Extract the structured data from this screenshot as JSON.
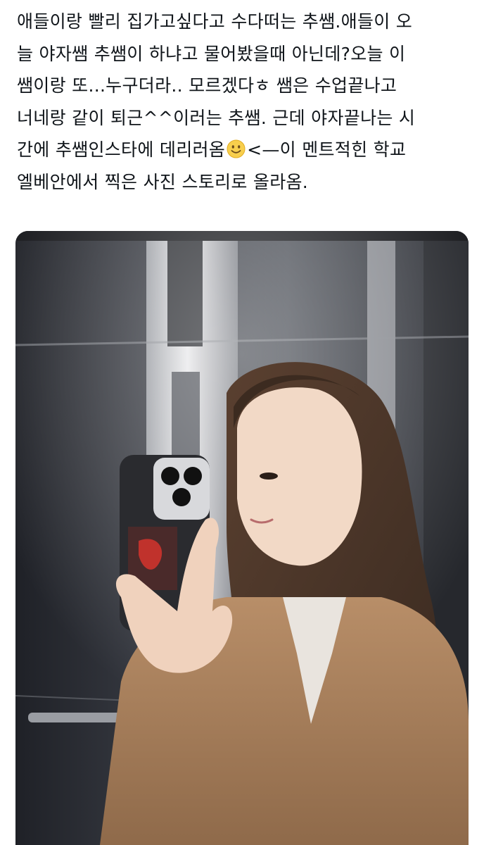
{
  "post": {
    "lines": [
      "애들이랑 빨리 집가고싶다고 수다떠는 추쌤.애들이 오",
      "늘 야자쌤 추쌤이 하냐고 물어봤을때 아닌데?오늘 이",
      "쌤이랑 또...누구더라.. 모르겠다ㅎ 쌤은 수업끝나고",
      "너네랑 같이 퇴근^^이러는 추쌤. 근데 야자끝나는 시",
      "간에 추쌤인스타에 데리러옴",
      "<—이 멘트적힌 학교",
      "엘베안에서 찍은 사진 스토리로 올라옴."
    ],
    "emoji": "slightly-smiling-face-emoji"
  },
  "media": {
    "description_icon": "photo-image"
  }
}
